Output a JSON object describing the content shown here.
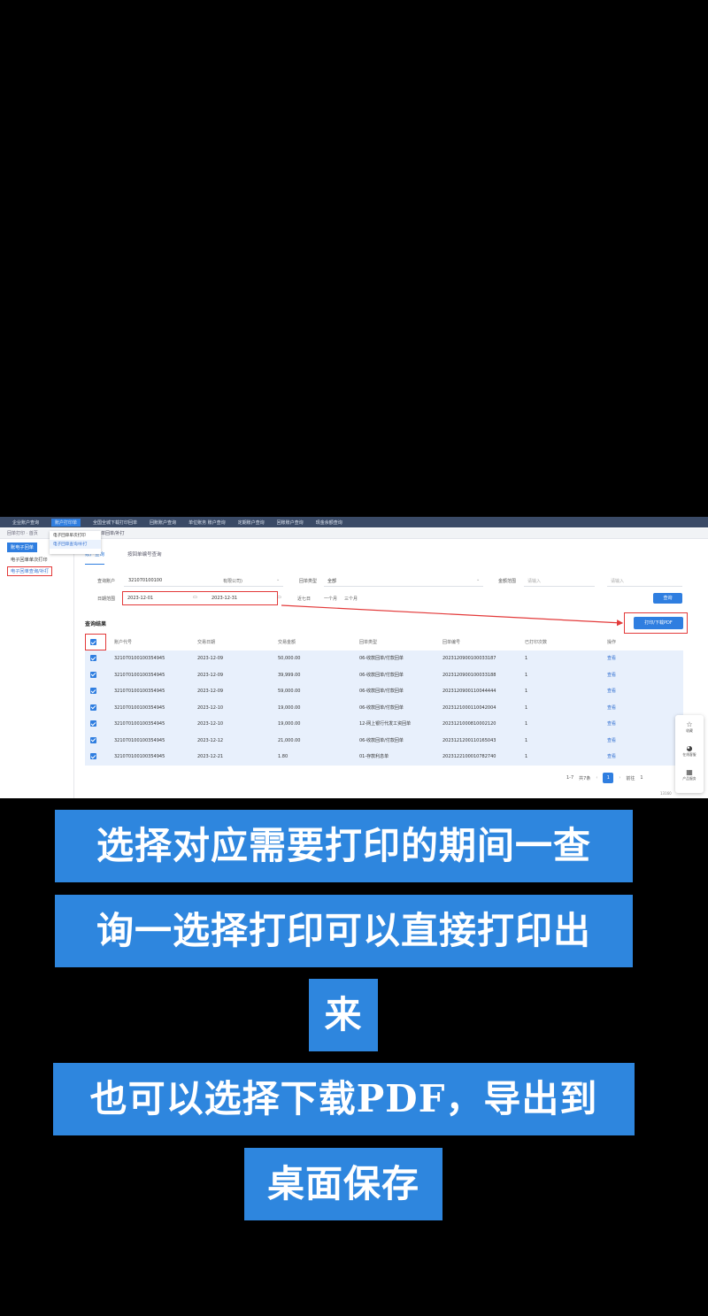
{
  "nav": {
    "items": [
      "企业账户查询",
      "账户打印单",
      "全国全城下载打印回单",
      "回账账户查询",
      "单位账务 账户查询",
      "定期账户查询",
      "回账账户查询",
      "现金余额查询"
    ],
    "active_index": 1
  },
  "breadcrumb": {
    "path": "回单打印 · 首页",
    "tab": "单回单/补打"
  },
  "sidebar": {
    "e_receipt": "账电子回单",
    "single_print": "电子回单单次打印",
    "query_reprint": "电子回单查询/补打"
  },
  "flyout": {
    "item1": "电子回单单次打印",
    "item2": "电子回单查询/补打"
  },
  "tabs": {
    "account_query": "账户查询",
    "receipt_no_query": "按回单编号查询"
  },
  "form": {
    "account_label": "查询账户",
    "account_value": "321070100100",
    "account_suffix": "有限公司)",
    "type_label": "回单类型",
    "type_value": "全部",
    "amount_label": "金额范围",
    "amount_min_placeholder": "请输入",
    "amount_max_placeholder": "请输入",
    "date_label": "日期范围",
    "date_start": "2023-12-01",
    "date_end": "2023-12-31",
    "quick_7d": "近七日",
    "quick_1m": "一个月",
    "quick_3m": "三个月",
    "query_button": "查询"
  },
  "results": {
    "title": "查询结果",
    "print_pdf_button": "打印/下载PDF",
    "columns": [
      "账户代号",
      "交易日期",
      "交易金额",
      "回单类型",
      "回单编号",
      "已打印次数",
      "操作"
    ],
    "rows": [
      {
        "account": "321070100100354945",
        "date": "2023-12-09",
        "amount": "50,000.00",
        "type": "06-收款回单/付款回单",
        "number": "2023120900100033187",
        "count": "1",
        "op": "查看"
      },
      {
        "account": "321070100100354945",
        "date": "2023-12-09",
        "amount": "39,999.00",
        "type": "06-收款回单/付款回单",
        "number": "2023120900100033188",
        "count": "1",
        "op": "查看"
      },
      {
        "account": "321070100100354945",
        "date": "2023-12-09",
        "amount": "59,000.00",
        "type": "06-收款回单/付款回单",
        "number": "2023120900110044444",
        "count": "1",
        "op": "查看"
      },
      {
        "account": "321070100100354945",
        "date": "2023-12-10",
        "amount": "19,000.00",
        "type": "06-收款回单/付款回单",
        "number": "2023121000110042004",
        "count": "1",
        "op": "查看"
      },
      {
        "account": "321070100100354945",
        "date": "2023-12-10",
        "amount": "19,000.00",
        "type": "12-网上银行代发工资回单",
        "number": "2023121000810002120",
        "count": "1",
        "op": "查看"
      },
      {
        "account": "321070100100354945",
        "date": "2023-12-12",
        "amount": "21,000.00",
        "type": "06-收款回单/付款回单",
        "number": "2023121200110165043",
        "count": "1",
        "op": "查看"
      },
      {
        "account": "321070100100354945",
        "date": "2023-12-21",
        "amount": "1.80",
        "type": "01-存款利息单",
        "number": "2023122100010782740",
        "count": "1",
        "op": "查看"
      }
    ]
  },
  "pager": {
    "range": "1-7",
    "total": "共7条",
    "page": "1",
    "jump_label": "前往",
    "jump_value": "1"
  },
  "rightbar": {
    "fav": "收藏",
    "service": "在线客服",
    "qr": "产品服务"
  },
  "footer_gray": "13160",
  "captions": [
    "选择对应需要打印的期间一查",
    "询一选择打印可以直接打印出",
    "来",
    "也可以选择下载PDF，导出到",
    "桌面保存"
  ],
  "colors": {
    "accent": "#2f7ee0",
    "caption_bg": "#2e86de",
    "highlight": "#e33a3a"
  }
}
